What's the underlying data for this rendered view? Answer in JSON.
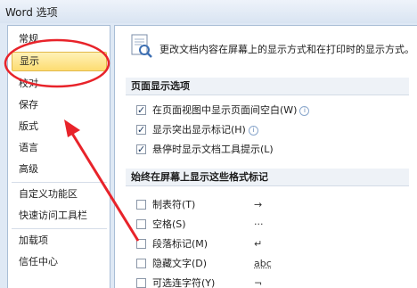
{
  "window": {
    "title": "Word 选项"
  },
  "sidebar": {
    "items": [
      {
        "label": "常规"
      },
      {
        "label": "显示",
        "selected": true
      },
      {
        "label": "校对"
      },
      {
        "label": "保存"
      },
      {
        "label": "版式"
      },
      {
        "label": "语言"
      },
      {
        "label": "高级"
      },
      {
        "label": "自定义功能区"
      },
      {
        "label": "快速访问工具栏"
      },
      {
        "label": "加载项"
      },
      {
        "label": "信任中心"
      }
    ]
  },
  "content": {
    "intro_text": "更改文档内容在屏幕上的显示方式和在打印时的显示方式。",
    "page_display_section": {
      "header": "页面显示选项",
      "options": [
        {
          "label": "在页面视图中显示页面间空白(W)",
          "checked": true,
          "info": true
        },
        {
          "label": "显示突出显示标记(H)",
          "checked": true,
          "info": true
        },
        {
          "label": "悬停时显示文档工具提示(L)",
          "checked": true,
          "info": false
        }
      ]
    },
    "format_marks_section": {
      "header": "始终在屏幕上显示这些格式标记",
      "options": [
        {
          "label": "制表符(T)",
          "checked": false,
          "symbol": "→"
        },
        {
          "label": "空格(S)",
          "checked": false,
          "symbol": "···"
        },
        {
          "label": "段落标记(M)",
          "checked": false,
          "symbol": "↵"
        },
        {
          "label": "隐藏文字(D)",
          "checked": false,
          "symbol": "abc"
        },
        {
          "label": "可选连字符(Y)",
          "checked": false,
          "symbol": "¬"
        }
      ]
    }
  },
  "colors": {
    "selected_item": "#fddc71",
    "annotation": "#e8232a",
    "checkbox_check": "#1f3c63"
  }
}
